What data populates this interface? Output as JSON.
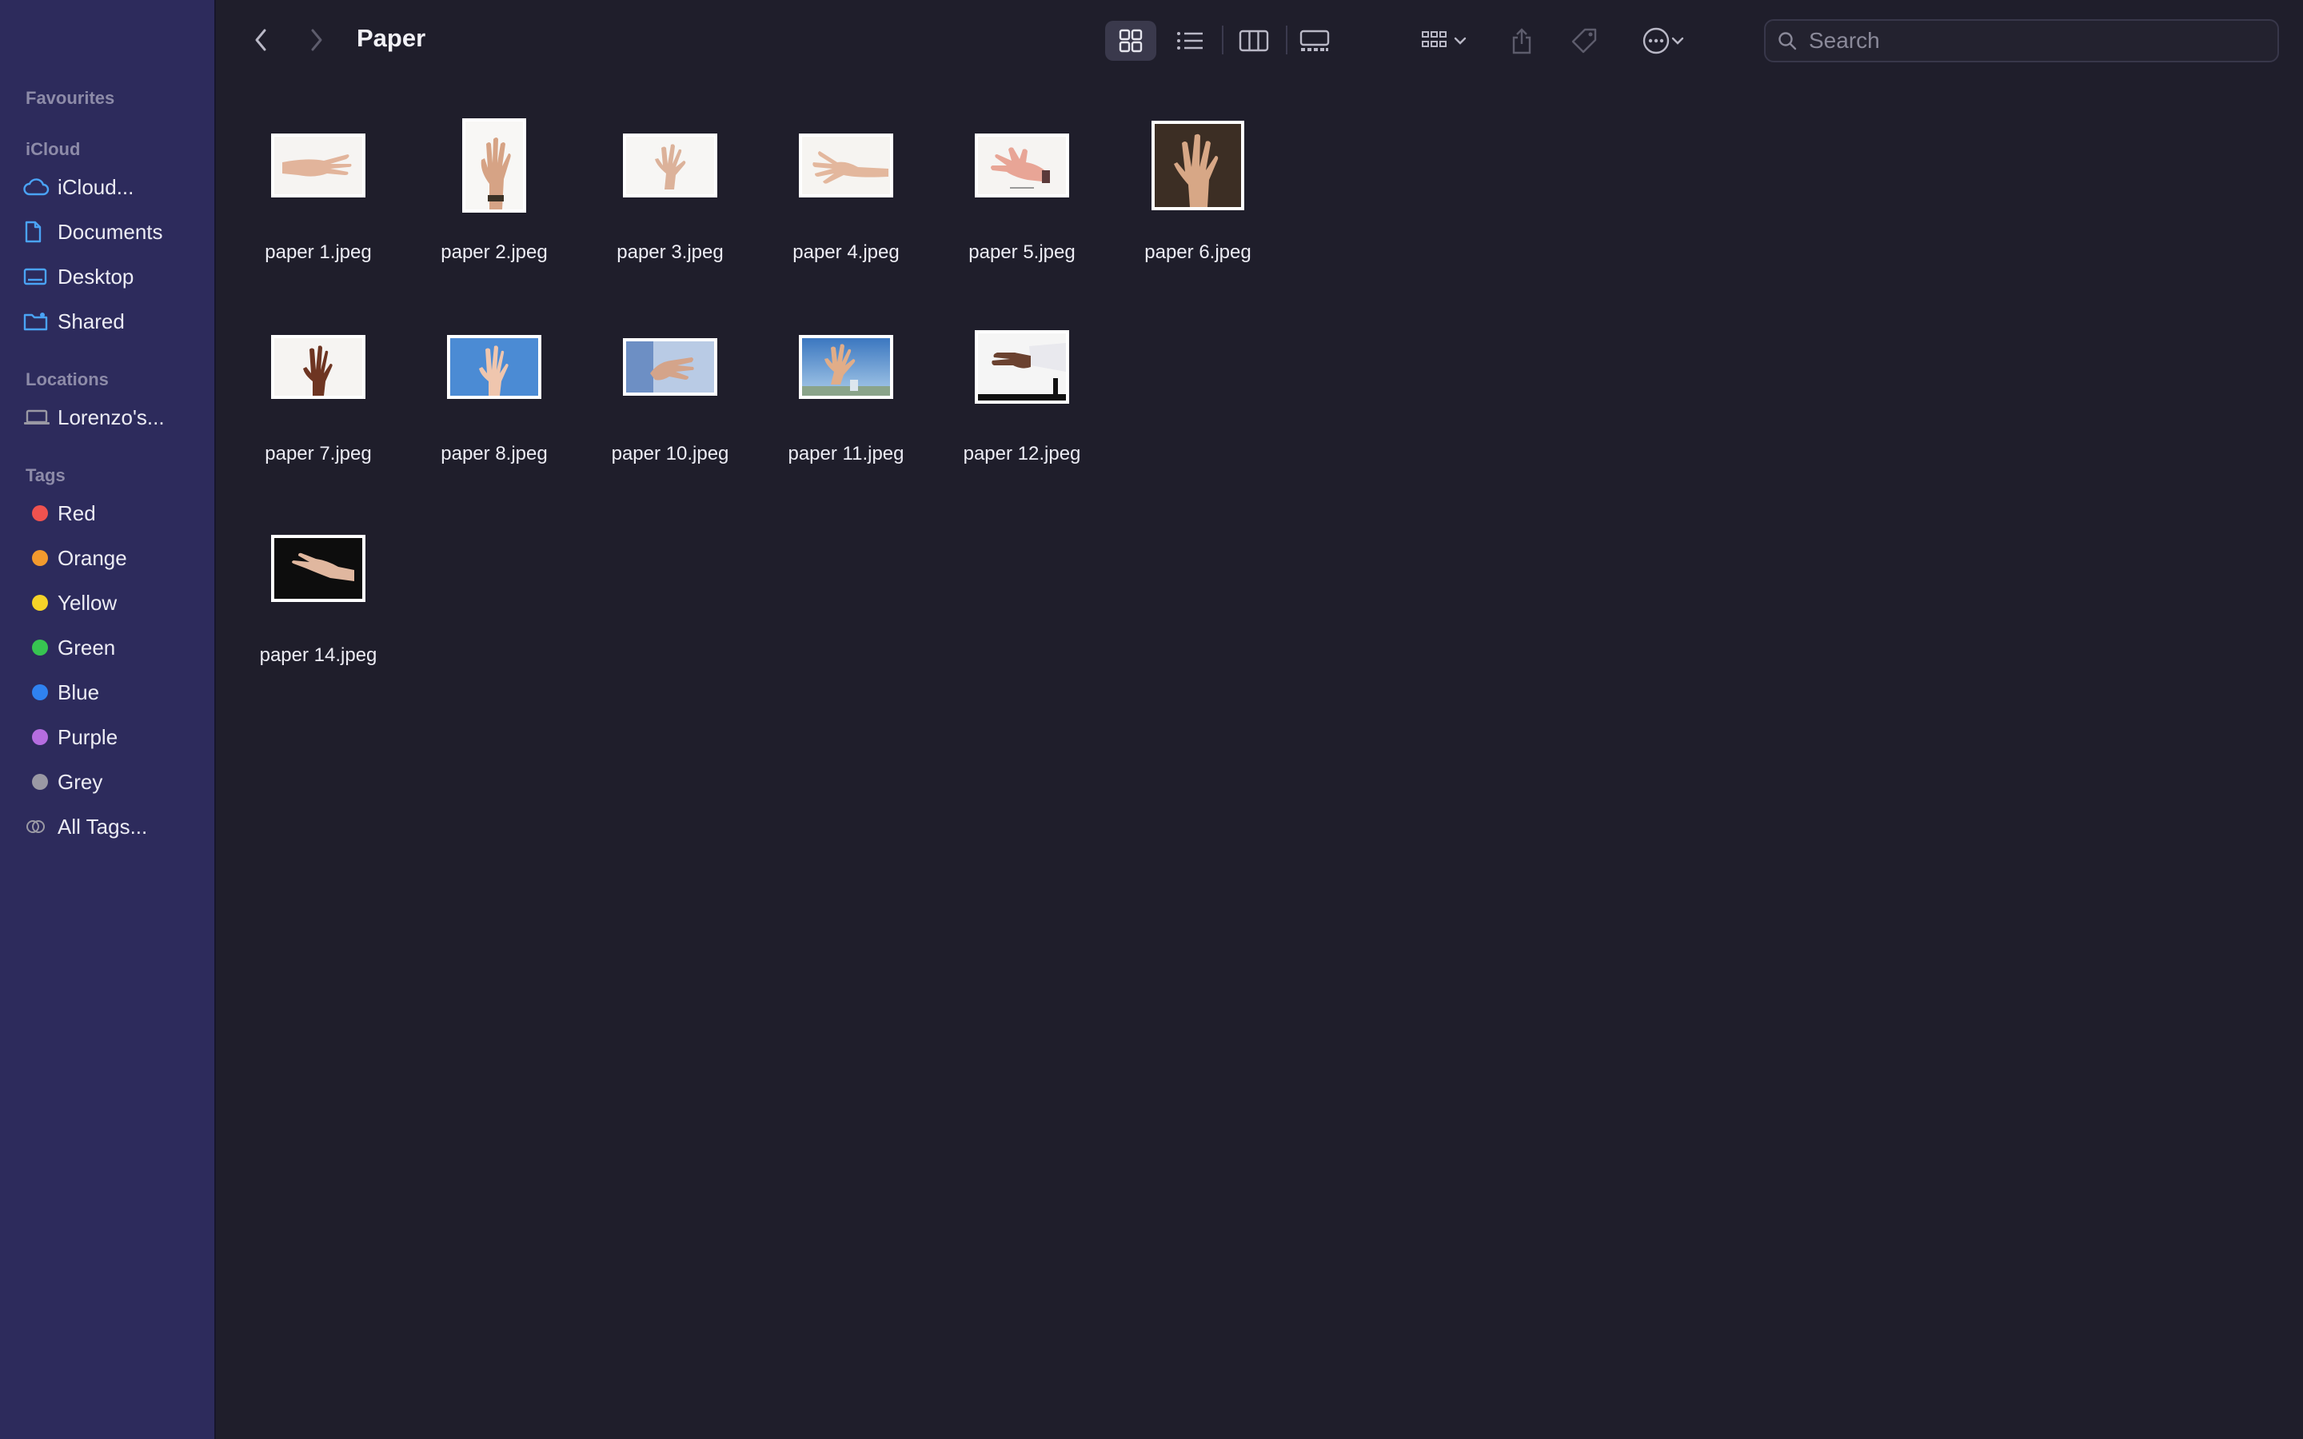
{
  "window": {
    "title": "Paper"
  },
  "sidebar": {
    "favourites_heading": "Favourites",
    "icloud_heading": "iCloud",
    "icloud_items": [
      {
        "label": "iCloud...",
        "icon": "cloud-icon"
      },
      {
        "label": "Documents",
        "icon": "document-icon"
      },
      {
        "label": "Desktop",
        "icon": "desktop-icon"
      },
      {
        "label": "Shared",
        "icon": "shared-folder-icon"
      }
    ],
    "locations_heading": "Locations",
    "location_items": [
      {
        "label": "Lorenzo's...",
        "icon": "laptop-icon"
      }
    ],
    "tags_heading": "Tags",
    "tags": [
      {
        "label": "Red",
        "color": "#f0524f"
      },
      {
        "label": "Orange",
        "color": "#f39a2e"
      },
      {
        "label": "Yellow",
        "color": "#f5d328"
      },
      {
        "label": "Green",
        "color": "#37c451"
      },
      {
        "label": "Blue",
        "color": "#2f82f0"
      },
      {
        "label": "Purple",
        "color": "#b56de0"
      },
      {
        "label": "Grey",
        "color": "#9a99a4"
      }
    ],
    "all_tags_label": "All Tags..."
  },
  "toolbar": {
    "back_icon": "chevron-left-icon",
    "forward_icon": "chevron-right-icon",
    "view_modes": [
      "icon-view-icon",
      "list-view-icon",
      "column-view-icon",
      "gallery-view-icon"
    ],
    "group_icon": "group-grid-icon",
    "share_icon": "share-icon",
    "tag_icon": "tag-icon",
    "more_icon": "ellipsis-circle-icon"
  },
  "search": {
    "placeholder": "Search"
  },
  "files": [
    {
      "name": "paper 1.jpeg"
    },
    {
      "name": "paper 2.jpeg"
    },
    {
      "name": "paper 3.jpeg"
    },
    {
      "name": "paper 4.jpeg"
    },
    {
      "name": "paper 5.jpeg"
    },
    {
      "name": "paper 6.jpeg"
    },
    {
      "name": "paper 7.jpeg"
    },
    {
      "name": "paper 8.jpeg"
    },
    {
      "name": "paper 10.jpeg"
    },
    {
      "name": "paper 11.jpeg"
    },
    {
      "name": "paper 12.jpeg"
    },
    {
      "name": "paper 14.jpeg"
    }
  ]
}
